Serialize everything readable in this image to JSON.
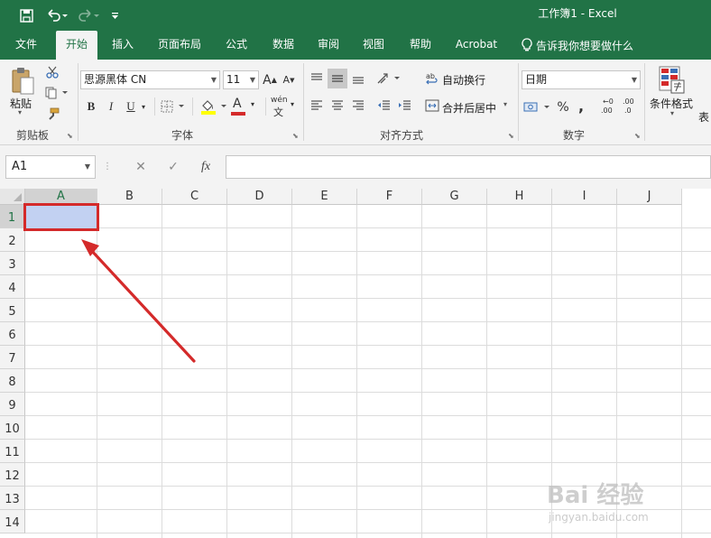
{
  "title_bar": {
    "document_title": "工作簿1  -  Excel",
    "save_icon": "save-icon",
    "undo_icon": "undo-icon",
    "redo_icon": "redo-icon",
    "customize_icon": "customize-qat-icon",
    "background_color": "#217346"
  },
  "ribbon_tabs": [
    {
      "label": "文件",
      "active": false
    },
    {
      "label": "开始",
      "active": true
    },
    {
      "label": "插入",
      "active": false
    },
    {
      "label": "页面布局",
      "active": false
    },
    {
      "label": "公式",
      "active": false
    },
    {
      "label": "数据",
      "active": false
    },
    {
      "label": "审阅",
      "active": false
    },
    {
      "label": "视图",
      "active": false
    },
    {
      "label": "帮助",
      "active": false
    },
    {
      "label": "Acrobat",
      "active": false
    }
  ],
  "tell_me": {
    "label": "告诉我你想要做什么",
    "icon": "lightbulb-icon"
  },
  "clipboard": {
    "paste_label": "粘贴",
    "group_label": "剪贴板",
    "cut_icon": "scissors-icon",
    "copy_icon": "copy-icon",
    "format_painter_icon": "format-painter-icon"
  },
  "font": {
    "font_name": "思源黑体 CN",
    "font_size": "11",
    "bold": "B",
    "italic": "I",
    "underline": "U",
    "grow_font": "A",
    "shrink_font": "A",
    "font_color": "A",
    "phonetic": "wén",
    "group_label": "字体",
    "font_color_value": "#d42a2a",
    "fill_color_value": "#ffff00"
  },
  "alignment": {
    "wrap_text": "自动换行",
    "merge_center": "合并后居中",
    "group_label": "对齐方式"
  },
  "number": {
    "format": "日期",
    "percent": "%",
    "comma": ",",
    "increase_decimal": ".00",
    "decrease_decimal": ".0",
    "group_label": "数字"
  },
  "styles": {
    "conditional_formatting": "条件格式",
    "table_format_partial": "表"
  },
  "formula_bar": {
    "name_box": "A1",
    "cancel": "✕",
    "enter": "✓",
    "fx": "fx",
    "value": ""
  },
  "sheet": {
    "columns": [
      "A",
      "B",
      "C",
      "D",
      "E",
      "F",
      "G",
      "H",
      "I",
      "J"
    ],
    "rows": [
      "1",
      "2",
      "3",
      "4",
      "5",
      "6",
      "7",
      "8",
      "9",
      "10",
      "11",
      "12",
      "13",
      "14"
    ],
    "selected_cell": "A1",
    "selected_fill": "#c2d1f2",
    "highlight_color": "#d42a2a",
    "accent_color": "#217346"
  },
  "watermark": {
    "logo": "Bai 经验",
    "url": "jingyan.baidu.com"
  }
}
